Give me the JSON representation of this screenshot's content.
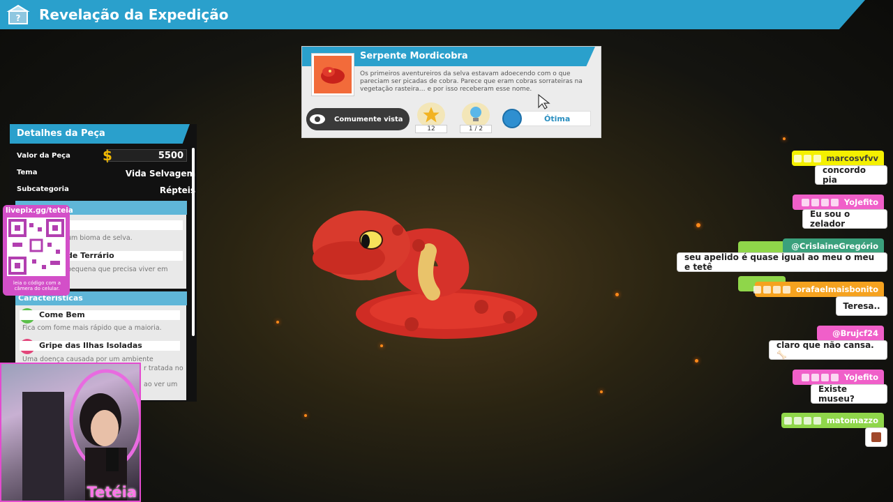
{
  "header": {
    "title": "Revelação da Expedição",
    "icon": "mystery-box-icon"
  },
  "piece": {
    "title": "Serpente Mordicobra",
    "description": "Os primeiros aventureiros da selva estavam adoecendo com o que pareciam ser picadas de cobra. Parece que eram cobras sorrateiras na vegetação rasteira… e por isso receberam esse nome.",
    "rarity": "Comumente vista",
    "star_count": "12",
    "idea_count": "1 / 2",
    "quality": "Ótima"
  },
  "details": {
    "title": "Detalhes da Peça",
    "value_label": "Valor da Peça",
    "value": "5500",
    "theme_label": "Tema",
    "theme": "Vida Selvagem",
    "subcategory_label": "Subcategoria",
    "subcategory": "Répteis",
    "biome_text": "um bioma de selva.",
    "terrain_label": "de Terrário",
    "terrain_text": "pequena que precisa viver em",
    "traits_header": "Características",
    "traits": [
      {
        "name": "Come Bem",
        "text": "Fica com fome mais rápido que a maioria."
      },
      {
        "name": "Gripe das Ilhas Isoladas",
        "text": "Uma doença causada por um ambiente",
        "text2": "r tratada no",
        "text3": "ao ver um"
      }
    ]
  },
  "overlay": {
    "qr_url": "livepix.gg/teteia",
    "qr_caption": "leia o código com a câmera do celular.",
    "streamer_name": "Tetéia"
  },
  "chat": [
    {
      "user": "marcosvfvv",
      "msg": "concordo pia",
      "color": "#f4f000"
    },
    {
      "user": "YoJefito",
      "msg": "Eu sou o zelador",
      "color": "#f05fc9"
    },
    {
      "user": "@CrislaineGregório",
      "msg": "seu apelido é quase igual ao meu o meu e tetê",
      "color": "#3aa07c"
    },
    {
      "user": "orafaelmaisbonito",
      "msg": "Teresa..",
      "color": "#f5a21f"
    },
    {
      "user": "@Brujcf24",
      "msg": "claro que não cansa. 🦴",
      "color": "#f05fc9"
    },
    {
      "user": "YoJefito",
      "msg": "Existe museu?",
      "color": "#f05fc9"
    },
    {
      "user": "matomazzo",
      "msg": "",
      "color": "#8fd64a"
    }
  ]
}
